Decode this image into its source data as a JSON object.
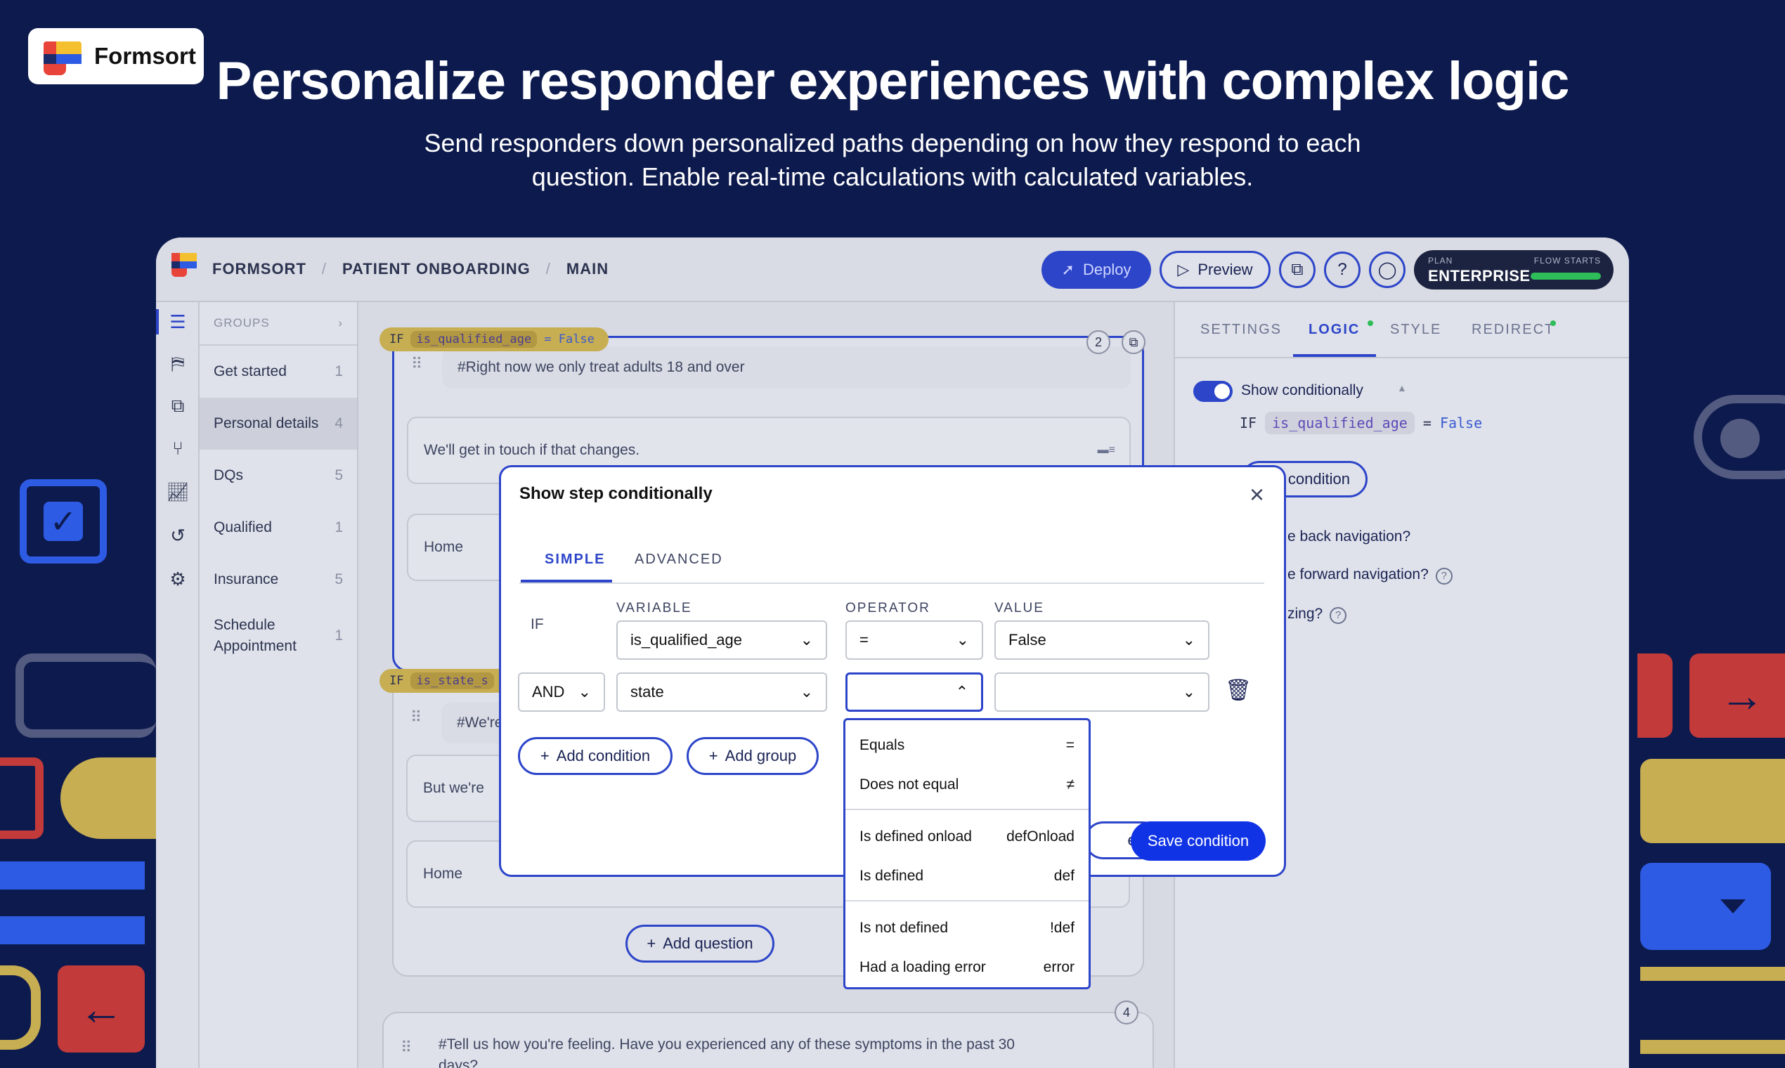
{
  "brand": {
    "name": "Formsort"
  },
  "hero": {
    "headline": "Personalize responder experiences with complex logic",
    "sub_line1": "Send responders down personalized paths depending on how they respond to each",
    "sub_line2": "question. Enable real-time calculations with calculated variables."
  },
  "colors": {
    "background": "#0d1a4d",
    "accent": "#1133e6",
    "condition_pill": "#c7ae52",
    "success": "#2ebd59"
  },
  "topbar": {
    "breadcrumb": [
      "FORMSORT",
      "PATIENT ONBOARDING",
      "MAIN"
    ],
    "deploy_label": "Deploy",
    "preview_label": "Preview",
    "plan_label": "PLAN",
    "plan_value": "ENTERPRISE",
    "flow_starts_label": "FLOW STARTS",
    "icons": [
      "copy-icon",
      "help-icon",
      "user-icon"
    ]
  },
  "rail": {
    "icons": [
      "list-icon",
      "signpost-icon",
      "flow-icon",
      "branch-icon",
      "chart-icon",
      "history-icon",
      "settings-icon"
    ]
  },
  "groups": {
    "header": "GROUPS",
    "items": [
      {
        "label": "Get started",
        "count": "1"
      },
      {
        "label": "Personal details",
        "count": "4"
      },
      {
        "label": "DQs",
        "count": "5"
      },
      {
        "label": "Qualified",
        "count": "1"
      },
      {
        "label": "Insurance",
        "count": "5"
      },
      {
        "label": "Schedule",
        "label2": "Appointment",
        "count": "1"
      }
    ]
  },
  "canvas": {
    "step1": {
      "if_kw": "IF",
      "variable": "is_qualified_age",
      "op_value": "= False",
      "badge": "2",
      "q1": "#Right now we only treat adults 18 and over",
      "q2": "We'll get in touch if that changes.",
      "q3": "Home"
    },
    "step2": {
      "if_kw": "IF",
      "variable": "is_state_s",
      "q1": "#We're",
      "q2": "But we're",
      "q3": "Home",
      "add_question": "Add question"
    },
    "step3": {
      "badge": "4",
      "q1": "#Tell us how you're feeling. Have you experienced any of these symptoms in the past 30",
      "q1b": "days?"
    }
  },
  "right_panel": {
    "tabs": [
      "SETTINGS",
      "LOGIC",
      "STYLE",
      "REDIRECT"
    ],
    "show_conditionally": "Show conditionally",
    "if_kw": "IF",
    "variable": "is_qualified_age",
    "op": "=",
    "value": "False",
    "condition_btn": "condition",
    "back_nav": "e back navigation?",
    "forward_nav": "e forward navigation?",
    "third": "zing?"
  },
  "modal": {
    "title": "Show step conditionally",
    "tabs": [
      "SIMPLE",
      "ADVANCED"
    ],
    "columns": {
      "variable": "VARIABLE",
      "operator": "OPERATOR",
      "value": "VALUE"
    },
    "row1": {
      "prefix": "IF",
      "variable": "is_qualified_age",
      "operator": "=",
      "value": "False"
    },
    "row2": {
      "prefix": "AND",
      "variable": "state",
      "operator": "",
      "value": ""
    },
    "add_condition": "Add condition",
    "add_group": "Add group",
    "cancel": "el",
    "save": "Save condition"
  },
  "dropdown": {
    "items": [
      {
        "label": "Equals",
        "sym": "="
      },
      {
        "label": "Does not equal",
        "sym": "≠"
      },
      {
        "label": "Is defined onload",
        "sym": "defOnload"
      },
      {
        "label": "Is defined",
        "sym": "def"
      },
      {
        "label": "Is not defined",
        "sym": "!def"
      },
      {
        "label": "Had a loading error",
        "sym": "error"
      }
    ]
  }
}
